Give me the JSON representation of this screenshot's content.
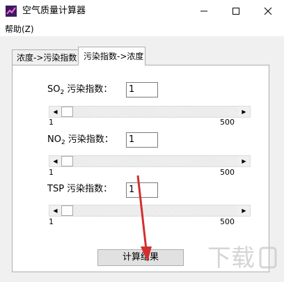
{
  "window": {
    "title": "空气质量计算器",
    "accent": "#7b2fbe"
  },
  "menu": {
    "help": "帮助(Z)"
  },
  "tabs": [
    {
      "label": "浓度->污染指数",
      "active": false
    },
    {
      "label": "污染指数->浓度",
      "active": true
    }
  ],
  "fields": [
    {
      "label_main": "SO",
      "label_sub": "2",
      "label_rest": " 污染指数：",
      "value": "1",
      "slider": {
        "min": "1",
        "max": "500",
        "value": 1
      }
    },
    {
      "label_main": "NO",
      "label_sub": "2",
      "label_rest": " 污染指数：",
      "value": "1",
      "slider": {
        "min": "1",
        "max": "500",
        "value": 1
      }
    },
    {
      "label_main": "TSP 污染指数：",
      "label_sub": "",
      "label_rest": "",
      "value": "1",
      "slider": {
        "min": "1",
        "max": "500",
        "value": 1
      }
    }
  ],
  "actions": {
    "calculate": "计算结果"
  },
  "annotation": {
    "arrow_color": "#d32f2f"
  }
}
